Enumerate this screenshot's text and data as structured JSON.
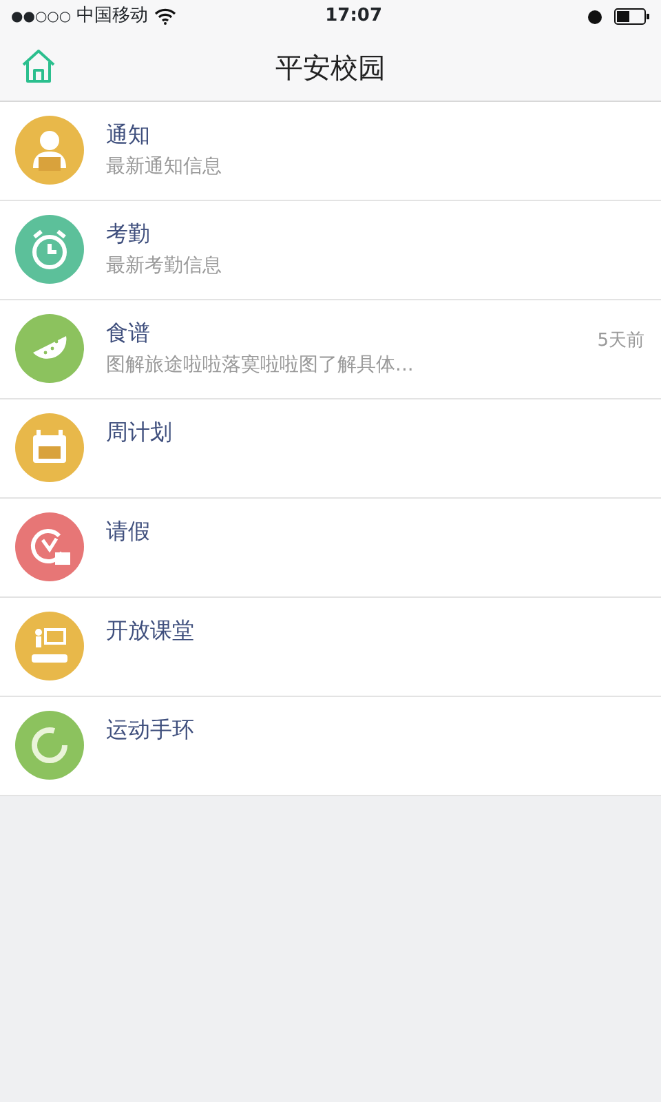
{
  "status_bar": {
    "signal": "●●○○○",
    "carrier": "中国移动",
    "time": "17:07"
  },
  "nav_bar": {
    "title": "平安校园"
  },
  "items": [
    {
      "kind": "person",
      "color": "#e8b84a",
      "title": "通知",
      "subtitle": "最新通知信息"
    },
    {
      "kind": "clock",
      "color": "#5cc09a",
      "title": "考勤",
      "subtitle": "最新考勤信息"
    },
    {
      "kind": "melon",
      "color": "#8cc25e",
      "title": "食谱",
      "subtitle": "图解旅途啦啦落寞啦啦图了解具体...",
      "time": "5天前"
    },
    {
      "kind": "calendar",
      "color": "#e8b84a",
      "title": "周计划"
    },
    {
      "kind": "leave",
      "color": "#e77676",
      "title": "请假"
    },
    {
      "kind": "classroom",
      "color": "#e8b84a",
      "title": "开放课堂"
    },
    {
      "kind": "band",
      "color": "#8cc25e",
      "title": "运动手环"
    }
  ]
}
